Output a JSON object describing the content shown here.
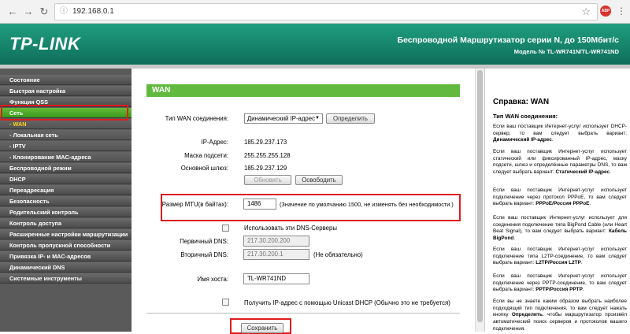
{
  "browser": {
    "url": "192.168.0.1",
    "ext_label": "ABP"
  },
  "header": {
    "logo": "TP-LINK",
    "title": "Беспроводной Маршрутизатор серии N, до 150Мбит/с",
    "model": "Модель № TL-WR741N/TL-WR741ND"
  },
  "sidebar": {
    "items": [
      {
        "label": "Состояние"
      },
      {
        "label": "Быстрая настройка"
      },
      {
        "label": "Функция QSS"
      },
      {
        "label": "Сеть"
      },
      {
        "label": "- WAN"
      },
      {
        "label": "- Локальная сеть"
      },
      {
        "label": "- IPTV"
      },
      {
        "label": "- Клонирование MAC-адреса"
      },
      {
        "label": "Беспроводной режим"
      },
      {
        "label": "DHCP"
      },
      {
        "label": "Переадресация"
      },
      {
        "label": "Безопасность"
      },
      {
        "label": "Родительский контроль"
      },
      {
        "label": "Контроль доступа"
      },
      {
        "label": "Расширенные настройки маршрутизации"
      },
      {
        "label": "Контроль пропускной способности"
      },
      {
        "label": "Привязка IP- и MAC-адресов"
      },
      {
        "label": "Динамический DNS"
      },
      {
        "label": "Системные инструменты"
      }
    ]
  },
  "main": {
    "section_title": "WAN",
    "wan_type_label": "Тип WAN соединения:",
    "wan_type_value": "Динамический IP-адрес",
    "detect_button": "Определить",
    "ip_label": "IP-Адрес:",
    "ip_value": "185.29.237.173",
    "mask_label": "Маска подсети:",
    "mask_value": "255.255.255.128",
    "gateway_label": "Основной шлюз:",
    "gateway_value": "185.29.237.129",
    "renew_button": "Обновить",
    "release_button": "Освободить",
    "mtu_label": "Размер MTU(в байтах):",
    "mtu_value": "1486",
    "mtu_hint": "(Значение по умолчанию 1500, не изменять без необходимости.)",
    "use_dns_label": "Использовать эти DNS-Серверы",
    "primary_dns_label": "Первичный DNS:",
    "primary_dns_value": "217.30.200.200",
    "secondary_dns_label": "Вторичный DNS:",
    "secondary_dns_value": "217.30.200.1",
    "optional_label": "(Не обязательно)",
    "host_label": "Имя хоста:",
    "host_value": "TL-WR741ND",
    "unicast_label": "Получить IP-адрес с помощью Unicast DHCP (Обычно это не требуется)",
    "save_button": "Сохранить"
  },
  "help": {
    "title": "Справка: WAN",
    "subtitle": "Тип WAN соединения:",
    "p1_text": "Если ваш поставщик Интернет-услуг использует DHCP-сервер, то вам следует выбрать вариант:",
    "p1_bold": "Динамический IP-адрес",
    "p2_text": "Если ваш поставщик Интернет-услуг использует статический или фиксированный IP-адрес, маску подсети, шлюз и определённые параметры DNS, то вам следует выбрать вариант:",
    "p2_bold": "Статический IP-адрес",
    "p3_text": "Если ваш поставщик Интернет-услуг использует подключение через протокол PPPoE, то вам следует выбрать вариант:",
    "p3_bold": "PPPoE/Россия PPPoE",
    "p4_text": "Если ваш поставщик Интернет-услуг использует для соединения подключение типа BigPond Cable (или Heart Beat Signal), то вам следует выбрать вариант:",
    "p4_bold": "Кабель BigPond",
    "p5_text": "Если ваш поставщик Интернет-услуг использует подключение типа L2TP-соединение, то вам следует выбрать вариант:",
    "p5_bold": "L2TP/Россия L2TP",
    "p6_text": "Если ваш поставщик Интернет-услуг использует подключение через PPTP-соединение, то вам следует выбрать вариант:",
    "p6_bold": "PPTP/Россия PPTP",
    "p7_text": "Если вы не знаете каким образом выбрать наиболее подходящий тип подключения, то вам следует нажать кнопку",
    "p7_bold": "Определить",
    "p7_tail": ", чтобы маршрутизатор произвёл автоматический поиск серверов и протоколов вашего подключения."
  },
  "colors": {
    "header": "#1a8a70",
    "accent_green": "#62b93f",
    "highlight_red": "#e01c1c",
    "sidebar_bg": "#5a5a5a"
  }
}
